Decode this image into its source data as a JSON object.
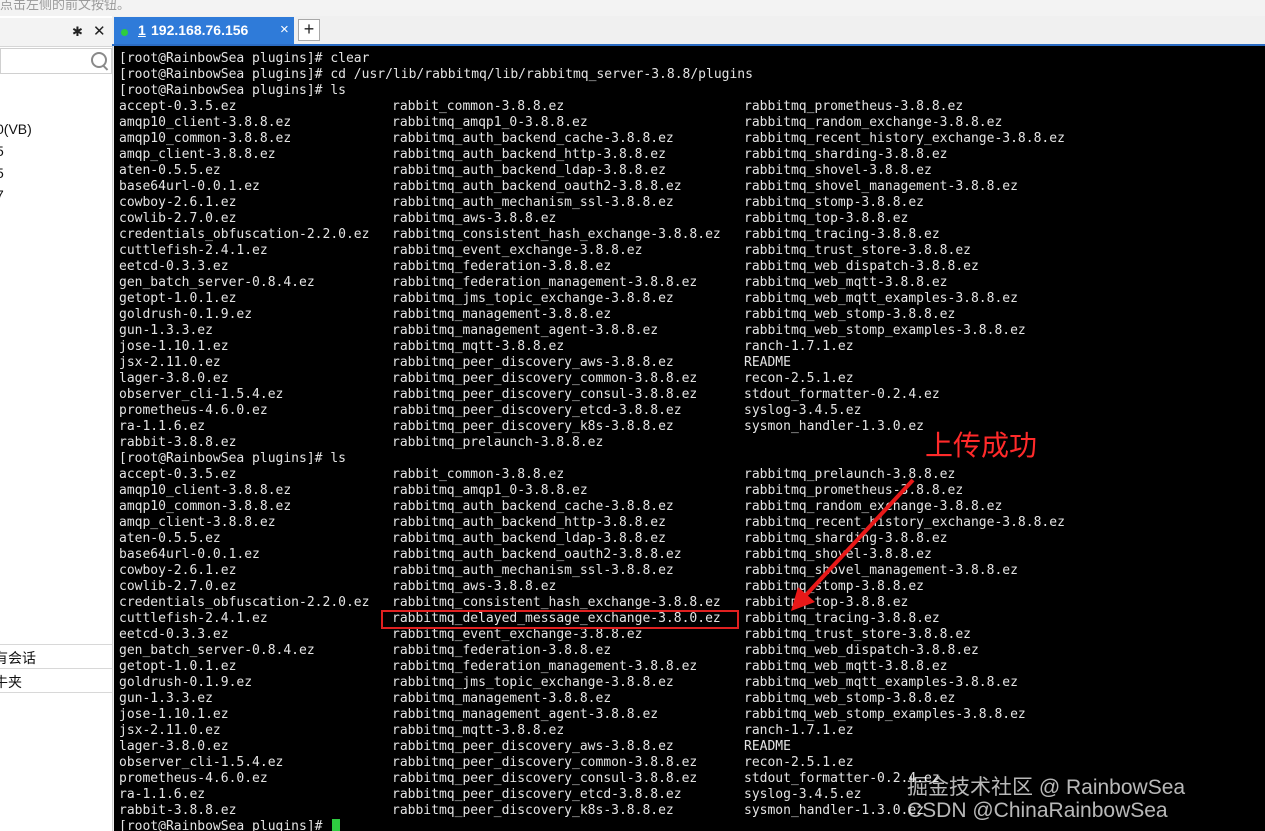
{
  "top_hint": "点击左侧的前文按钮。",
  "sidebar": {
    "pin_icon": "pin-icon",
    "close_icon": "close-icon",
    "search_icon": "search-icon",
    "tree_items": [
      "0(VB)",
      "5",
      "5",
      "7"
    ],
    "footer_rows": [
      "有会话",
      "牛夹",
      ""
    ]
  },
  "tab": {
    "index": "1",
    "title": "192.168.76.156",
    "close": "×",
    "new_tab": "+"
  },
  "terminal": {
    "lines": [
      [
        "[root@RainbowSea plugins]# clear",
        "",
        ""
      ],
      [
        "[root@RainbowSea plugins]# cd /usr/lib/rabbitmq/lib/rabbitmq_server-3.8.8/plugins",
        "",
        ""
      ],
      [
        "[root@RainbowSea plugins]# ls",
        "",
        ""
      ],
      [
        "accept-0.3.5.ez",
        "rabbit_common-3.8.8.ez",
        "rabbitmq_prometheus-3.8.8.ez"
      ],
      [
        "amqp10_client-3.8.8.ez",
        "rabbitmq_amqp1_0-3.8.8.ez",
        "rabbitmq_random_exchange-3.8.8.ez"
      ],
      [
        "amqp10_common-3.8.8.ez",
        "rabbitmq_auth_backend_cache-3.8.8.ez",
        "rabbitmq_recent_history_exchange-3.8.8.ez"
      ],
      [
        "amqp_client-3.8.8.ez",
        "rabbitmq_auth_backend_http-3.8.8.ez",
        "rabbitmq_sharding-3.8.8.ez"
      ],
      [
        "aten-0.5.5.ez",
        "rabbitmq_auth_backend_ldap-3.8.8.ez",
        "rabbitmq_shovel-3.8.8.ez"
      ],
      [
        "base64url-0.0.1.ez",
        "rabbitmq_auth_backend_oauth2-3.8.8.ez",
        "rabbitmq_shovel_management-3.8.8.ez"
      ],
      [
        "cowboy-2.6.1.ez",
        "rabbitmq_auth_mechanism_ssl-3.8.8.ez",
        "rabbitmq_stomp-3.8.8.ez"
      ],
      [
        "cowlib-2.7.0.ez",
        "rabbitmq_aws-3.8.8.ez",
        "rabbitmq_top-3.8.8.ez"
      ],
      [
        "credentials_obfuscation-2.2.0.ez",
        "rabbitmq_consistent_hash_exchange-3.8.8.ez",
        "rabbitmq_tracing-3.8.8.ez"
      ],
      [
        "cuttlefish-2.4.1.ez",
        "rabbitmq_event_exchange-3.8.8.ez",
        "rabbitmq_trust_store-3.8.8.ez"
      ],
      [
        "eetcd-0.3.3.ez",
        "rabbitmq_federation-3.8.8.ez",
        "rabbitmq_web_dispatch-3.8.8.ez"
      ],
      [
        "gen_batch_server-0.8.4.ez",
        "rabbitmq_federation_management-3.8.8.ez",
        "rabbitmq_web_mqtt-3.8.8.ez"
      ],
      [
        "getopt-1.0.1.ez",
        "rabbitmq_jms_topic_exchange-3.8.8.ez",
        "rabbitmq_web_mqtt_examples-3.8.8.ez"
      ],
      [
        "goldrush-0.1.9.ez",
        "rabbitmq_management-3.8.8.ez",
        "rabbitmq_web_stomp-3.8.8.ez"
      ],
      [
        "gun-1.3.3.ez",
        "rabbitmq_management_agent-3.8.8.ez",
        "rabbitmq_web_stomp_examples-3.8.8.ez"
      ],
      [
        "jose-1.10.1.ez",
        "rabbitmq_mqtt-3.8.8.ez",
        "ranch-1.7.1.ez"
      ],
      [
        "jsx-2.11.0.ez",
        "rabbitmq_peer_discovery_aws-3.8.8.ez",
        "README"
      ],
      [
        "lager-3.8.0.ez",
        "rabbitmq_peer_discovery_common-3.8.8.ez",
        "recon-2.5.1.ez"
      ],
      [
        "observer_cli-1.5.4.ez",
        "rabbitmq_peer_discovery_consul-3.8.8.ez",
        "stdout_formatter-0.2.4.ez"
      ],
      [
        "prometheus-4.6.0.ez",
        "rabbitmq_peer_discovery_etcd-3.8.8.ez",
        "syslog-3.4.5.ez"
      ],
      [
        "ra-1.1.6.ez",
        "rabbitmq_peer_discovery_k8s-3.8.8.ez",
        "sysmon_handler-1.3.0.ez"
      ],
      [
        "rabbit-3.8.8.ez",
        "rabbitmq_prelaunch-3.8.8.ez",
        ""
      ],
      [
        "[root@RainbowSea plugins]# ls",
        "",
        ""
      ],
      [
        "accept-0.3.5.ez",
        "rabbit_common-3.8.8.ez",
        "rabbitmq_prelaunch-3.8.8.ez"
      ],
      [
        "amqp10_client-3.8.8.ez",
        "rabbitmq_amqp1_0-3.8.8.ez",
        "rabbitmq_prometheus-3.8.8.ez"
      ],
      [
        "amqp10_common-3.8.8.ez",
        "rabbitmq_auth_backend_cache-3.8.8.ez",
        "rabbitmq_random_exchange-3.8.8.ez"
      ],
      [
        "amqp_client-3.8.8.ez",
        "rabbitmq_auth_backend_http-3.8.8.ez",
        "rabbitmq_recent_history_exchange-3.8.8.ez"
      ],
      [
        "aten-0.5.5.ez",
        "rabbitmq_auth_backend_ldap-3.8.8.ez",
        "rabbitmq_sharding-3.8.8.ez"
      ],
      [
        "base64url-0.0.1.ez",
        "rabbitmq_auth_backend_oauth2-3.8.8.ez",
        "rabbitmq_shovel-3.8.8.ez"
      ],
      [
        "cowboy-2.6.1.ez",
        "rabbitmq_auth_mechanism_ssl-3.8.8.ez",
        "rabbitmq_shovel_management-3.8.8.ez"
      ],
      [
        "cowlib-2.7.0.ez",
        "rabbitmq_aws-3.8.8.ez",
        "rabbitmq_stomp-3.8.8.ez"
      ],
      [
        "credentials_obfuscation-2.2.0.ez",
        "rabbitmq_consistent_hash_exchange-3.8.8.ez",
        "rabbitmq_top-3.8.8.ez"
      ],
      [
        "cuttlefish-2.4.1.ez",
        "rabbitmq_delayed_message_exchange-3.8.0.ez",
        "rabbitmq_tracing-3.8.8.ez"
      ],
      [
        "eetcd-0.3.3.ez",
        "rabbitmq_event_exchange-3.8.8.ez",
        "rabbitmq_trust_store-3.8.8.ez"
      ],
      [
        "gen_batch_server-0.8.4.ez",
        "rabbitmq_federation-3.8.8.ez",
        "rabbitmq_web_dispatch-3.8.8.ez"
      ],
      [
        "getopt-1.0.1.ez",
        "rabbitmq_federation_management-3.8.8.ez",
        "rabbitmq_web_mqtt-3.8.8.ez"
      ],
      [
        "goldrush-0.1.9.ez",
        "rabbitmq_jms_topic_exchange-3.8.8.ez",
        "rabbitmq_web_mqtt_examples-3.8.8.ez"
      ],
      [
        "gun-1.3.3.ez",
        "rabbitmq_management-3.8.8.ez",
        "rabbitmq_web_stomp-3.8.8.ez"
      ],
      [
        "jose-1.10.1.ez",
        "rabbitmq_management_agent-3.8.8.ez",
        "rabbitmq_web_stomp_examples-3.8.8.ez"
      ],
      [
        "jsx-2.11.0.ez",
        "rabbitmq_mqtt-3.8.8.ez",
        "ranch-1.7.1.ez"
      ],
      [
        "lager-3.8.0.ez",
        "rabbitmq_peer_discovery_aws-3.8.8.ez",
        "README"
      ],
      [
        "observer_cli-1.5.4.ez",
        "rabbitmq_peer_discovery_common-3.8.8.ez",
        "recon-2.5.1.ez"
      ],
      [
        "prometheus-4.6.0.ez",
        "rabbitmq_peer_discovery_consul-3.8.8.ez",
        "stdout_formatter-0.2.4.ez"
      ],
      [
        "ra-1.1.6.ez",
        "rabbitmq_peer_discovery_etcd-3.8.8.ez",
        "syslog-3.4.5.ez"
      ],
      [
        "rabbit-3.8.8.ez",
        "rabbitmq_peer_discovery_k8s-3.8.8.ez",
        "sysmon_handler-1.3.0.ez"
      ]
    ],
    "prompt": "[root@RainbowSea plugins]# "
  },
  "annotation": {
    "text": "上传成功",
    "color": "#ff2a2a"
  },
  "watermark": {
    "line1": "掘金技术社区 @ RainbowSea",
    "line2": "CSDN @ChinaRainbowSea"
  },
  "colors": {
    "tab_active": "#2f7bd9",
    "terminal_bg": "#000000",
    "cursor": "#2ecc40"
  }
}
